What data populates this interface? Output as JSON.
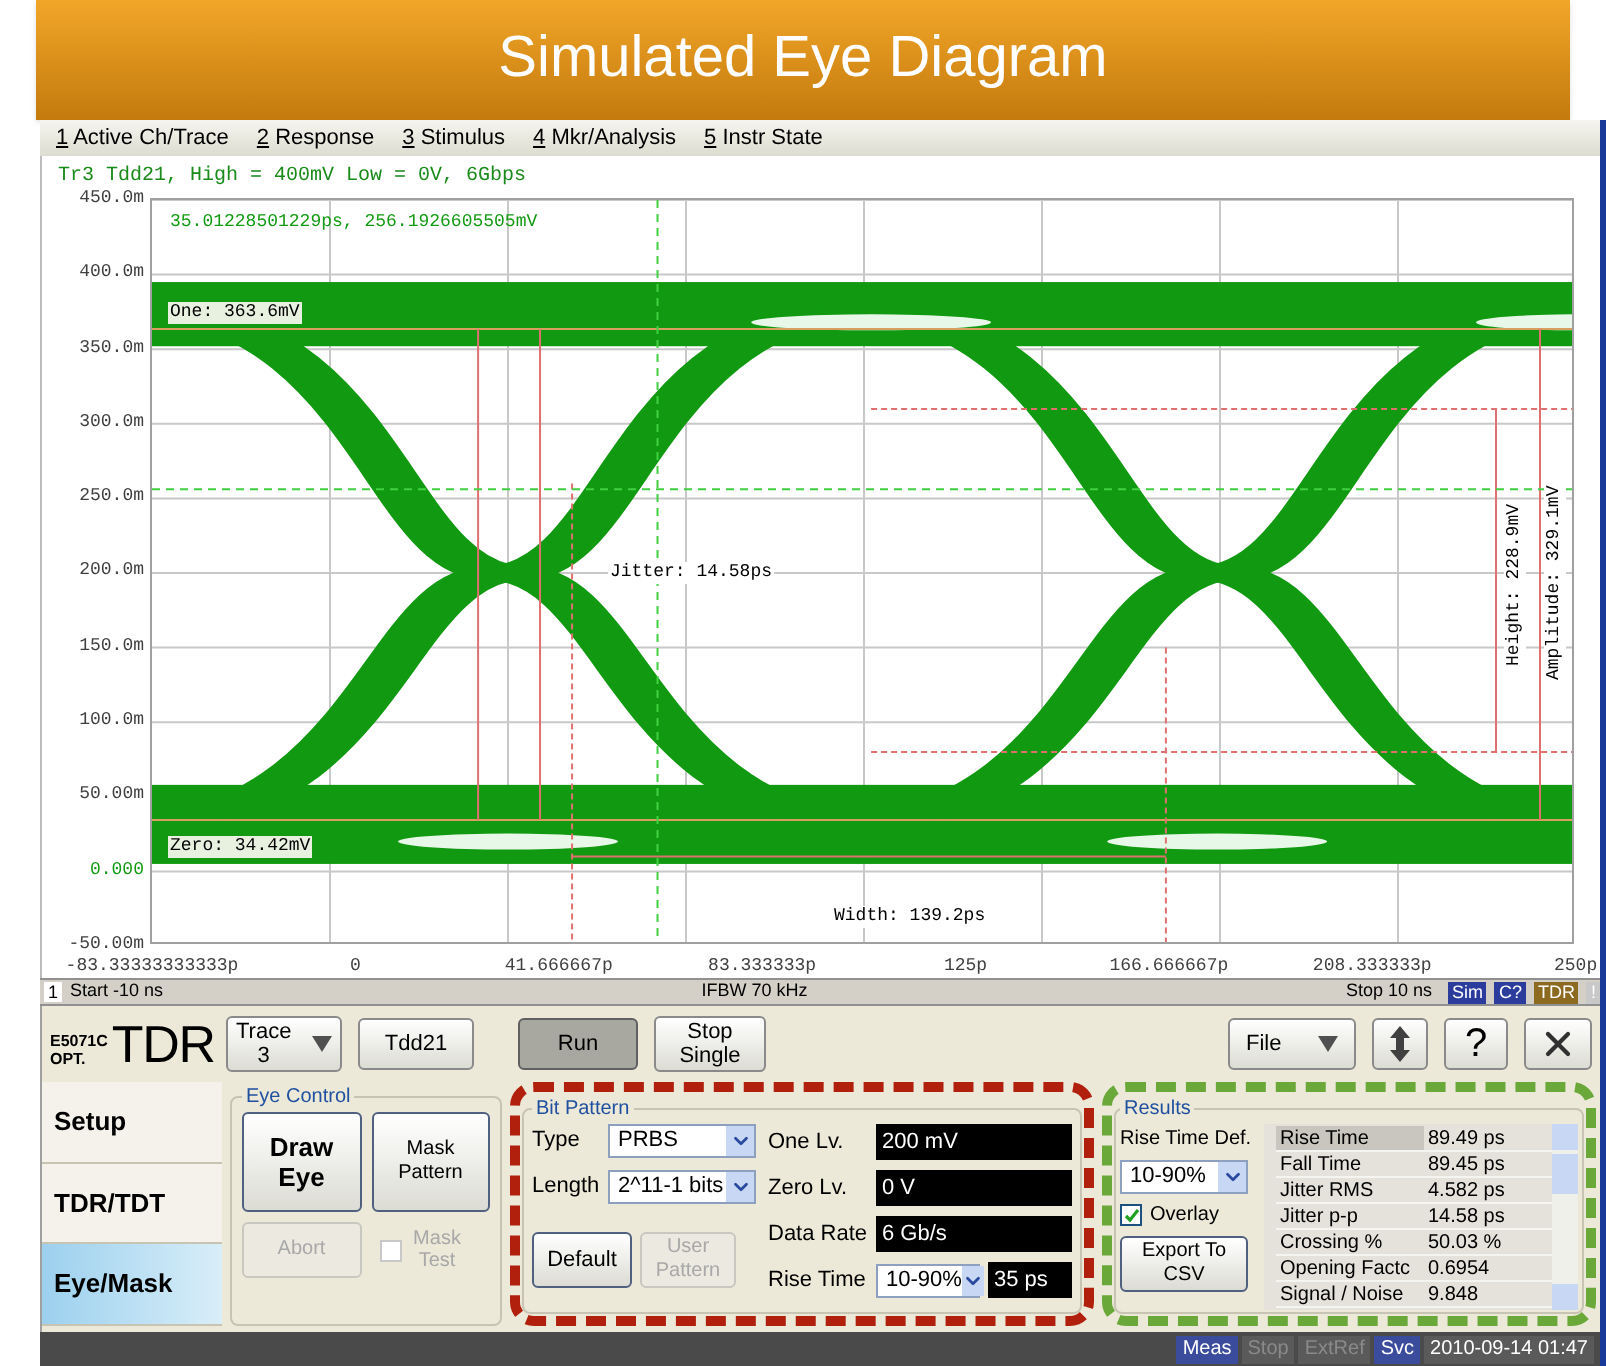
{
  "banner": {
    "title": "Simulated Eye Diagram"
  },
  "menu": [
    {
      "key": "1",
      "label": " Active Ch/Trace"
    },
    {
      "key": "2",
      "label": " Response"
    },
    {
      "key": "3",
      "label": " Stimulus"
    },
    {
      "key": "4",
      "label": " Mkr/Analysis"
    },
    {
      "key": "5",
      "label": " Instr State"
    }
  ],
  "trace_header": "Tr3 Tdd21, High = 400mV Low = 0V, 6Gbps",
  "plot": {
    "y_ticks": [
      "450.0m",
      "400.0m",
      "350.0m",
      "300.0m",
      "250.0m",
      "200.0m",
      "150.0m",
      "100.0m",
      "50.00m",
      "0.000",
      "-50.00m"
    ],
    "x_ticks": [
      "-83.33333333333p",
      "0",
      "41.666667p",
      "83.333333p",
      "125p",
      "166.666667p",
      "208.333333p",
      "250p"
    ],
    "annotations": [
      {
        "kind": "readout",
        "text": "35.01228501229ps, 256.1926605505mV"
      },
      {
        "kind": "one",
        "text": "One: 363.6mV"
      },
      {
        "kind": "zero",
        "text": "Zero: 34.42mV"
      },
      {
        "kind": "jitter",
        "text": "Jitter: 14.58ps"
      },
      {
        "kind": "width",
        "text": "Width: 139.2ps"
      },
      {
        "kind": "height",
        "text": "Height: 228.9mV"
      },
      {
        "kind": "amplitude",
        "text": "Amplitude: 329.1mV"
      }
    ]
  },
  "status_bar": {
    "channel": "1",
    "start": "Start -10 ns",
    "ifbw": "IFBW 70 kHz",
    "stop": "Stop 10 ns",
    "badges": [
      {
        "label": "Sim",
        "color": "#2c3c9c"
      },
      {
        "label": "C?",
        "color": "#2c3c9c"
      },
      {
        "label": "TDR",
        "color": "#8c6a20"
      },
      {
        "label": "!",
        "color": "#c8c8c8"
      }
    ]
  },
  "logo": {
    "model": "E5071C",
    "option": "OPT.",
    "name": "TDR"
  },
  "toolbar": {
    "trace": {
      "label": "Trace",
      "value": "3"
    },
    "parameter": "Tdd21",
    "run": {
      "label": "Run",
      "pressed": true
    },
    "stop": {
      "label": "Stop Single",
      "pressed": false
    },
    "file": "File",
    "help": "?"
  },
  "side_tabs": [
    {
      "label": "Setup",
      "selected": false
    },
    {
      "label": "TDR/TDT",
      "selected": false
    },
    {
      "label": "Eye/Mask",
      "selected": true
    }
  ],
  "eye_control": {
    "title": "Eye Control",
    "buttons": [
      {
        "label": "Draw Eye",
        "kind": "primary",
        "disabled": false
      },
      {
        "label": "Mask Pattern",
        "kind": "normal",
        "disabled": false
      },
      {
        "label": "Abort",
        "kind": "normal",
        "disabled": true
      }
    ],
    "mask_test": {
      "label": "Mask Test",
      "checked": false,
      "disabled": true
    }
  },
  "bit_pattern": {
    "title": "Bit Pattern",
    "selects": [
      {
        "label": "Type",
        "value": "PRBS"
      },
      {
        "label": "Length",
        "value": "2^11-1 bits"
      }
    ],
    "default": {
      "label": "Default",
      "disabled": false
    },
    "user_pattern": {
      "label": "User Pattern",
      "disabled": true
    },
    "fields": [
      {
        "label": "One Lv.",
        "value": "200 mV"
      },
      {
        "label": "Zero Lv.",
        "value": "0 V"
      },
      {
        "label": "Data Rate",
        "value": "6 Gb/s"
      }
    ],
    "rise_time": {
      "label": "Rise Time",
      "select": "10-90%",
      "value": "35 ps"
    }
  },
  "results": {
    "title": "Results",
    "rise_time_def": {
      "label": "Rise Time Def.",
      "value": "10-90%"
    },
    "overlay": {
      "label": "Overlay",
      "checked": true
    },
    "export": "Export To CSV",
    "rows": [
      {
        "name": "Rise Time",
        "value": "89.49 ps",
        "selected": true
      },
      {
        "name": "Fall Time",
        "value": "89.45 ps",
        "selected": false
      },
      {
        "name": "Jitter RMS",
        "value": "4.582 ps",
        "selected": false
      },
      {
        "name": "Jitter p-p",
        "value": "14.58 ps",
        "selected": false
      },
      {
        "name": "Crossing %",
        "value": "50.03 %",
        "selected": false
      },
      {
        "name": "Opening Factc",
        "value": "0.6954",
        "selected": false
      },
      {
        "name": "Signal / Noise",
        "value": "9.848",
        "selected": false
      }
    ]
  },
  "indicators": [
    {
      "label": "Meas",
      "active": true
    },
    {
      "label": "Stop",
      "active": false
    },
    {
      "label": "ExtRef",
      "active": false
    },
    {
      "label": "Svc",
      "active": true
    }
  ],
  "datetime": "2010-09-14 01:47"
}
